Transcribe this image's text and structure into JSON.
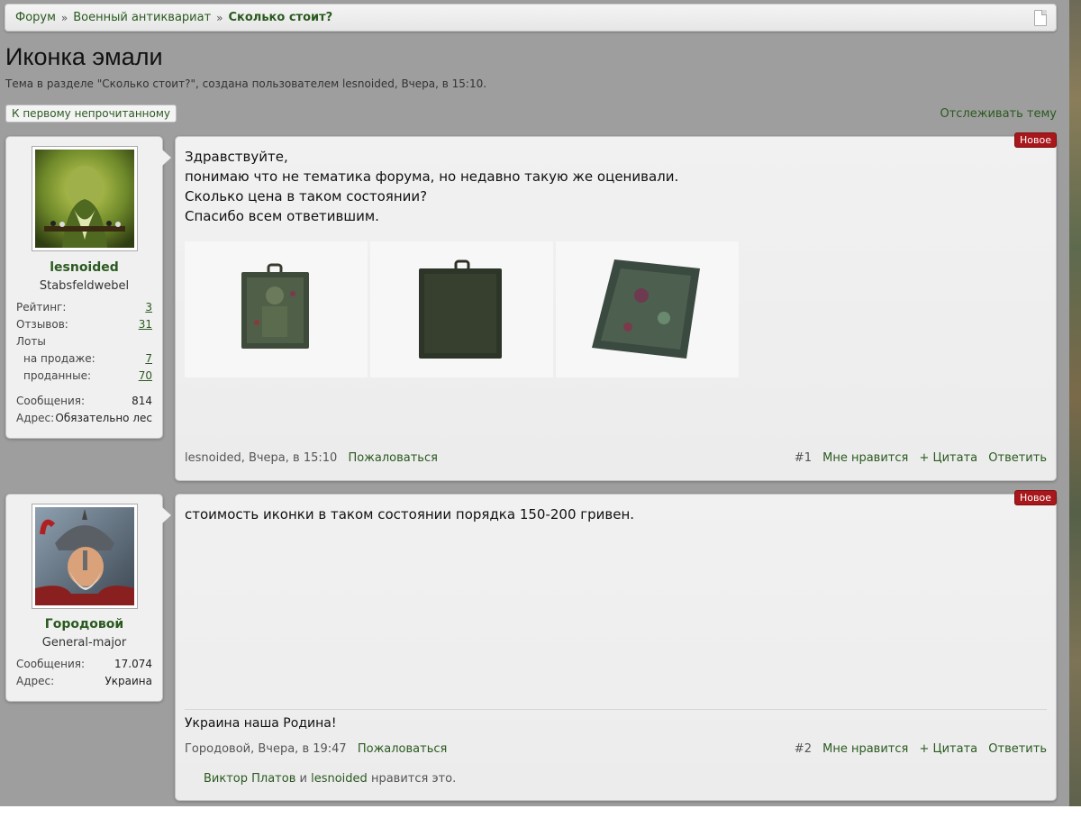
{
  "breadcrumb": {
    "items": [
      "Форум",
      "Военный антиквариат",
      "Сколько стоит?"
    ],
    "separator": "»"
  },
  "thread": {
    "title": "Иконка эмали",
    "subtitle": "Тема в разделе \"Сколько стоит?\", создана пользователем lesnoided, Вчера, в 15:10.",
    "first_unread_label": "К первому непрочитанному",
    "watch_label": "Отслеживать тему"
  },
  "posts": [
    {
      "user": {
        "name": "lesnoided",
        "rank": "Stabsfeldwebel",
        "stats": [
          {
            "key": "Рейтинг:",
            "value": "3"
          },
          {
            "key": "Отзывов:",
            "value": "31"
          },
          {
            "key": "Лоты",
            "value": ""
          },
          {
            "key": "на продаже:",
            "value": "7"
          },
          {
            "key": "проданные:",
            "value": "70"
          },
          {
            "key": "Сообщения:",
            "value": "814"
          },
          {
            "key": "Адрес:",
            "value": "Обязательно лес"
          }
        ]
      },
      "badge": "Новое",
      "message_lines": [
        "Здравствуйте,",
        "понимаю что не тематика форума, но недавно такую же оценивали.",
        "Сколько цена в таком состоянии?",
        "Спасибо всем ответившим."
      ],
      "meta": {
        "author_time": "lesnoided, Вчера, в 15:10",
        "report": "Пожаловаться"
      },
      "actions": {
        "number": "#1",
        "like": "Мне нравится",
        "quote": "+ Цитата",
        "reply": "Ответить"
      }
    },
    {
      "user": {
        "name": "Городовой",
        "rank": "General-major",
        "stats": [
          {
            "key": "Сообщения:",
            "value": "17.074"
          },
          {
            "key": "Адрес:",
            "value": "Украина"
          }
        ]
      },
      "badge": "Новое",
      "message_lines": [
        "стоимость иконки в таком состоянии порядка 150-200 гривен."
      ],
      "signature": "Украина наша Родина!",
      "meta": {
        "author_time": "Городовой, Вчера, в 19:47",
        "report": "Пожаловаться"
      },
      "actions": {
        "number": "#2",
        "like": "Мне нравится",
        "quote": "+ Цитата",
        "reply": "Ответить"
      },
      "likes": {
        "users": [
          "Виктор Платов",
          "lesnoided"
        ],
        "joiner": "и",
        "suffix": "нравится это."
      }
    }
  ],
  "colors": {
    "link": "#2a5a1f",
    "badge": "#a8171b",
    "background": "#9e9e9e"
  }
}
